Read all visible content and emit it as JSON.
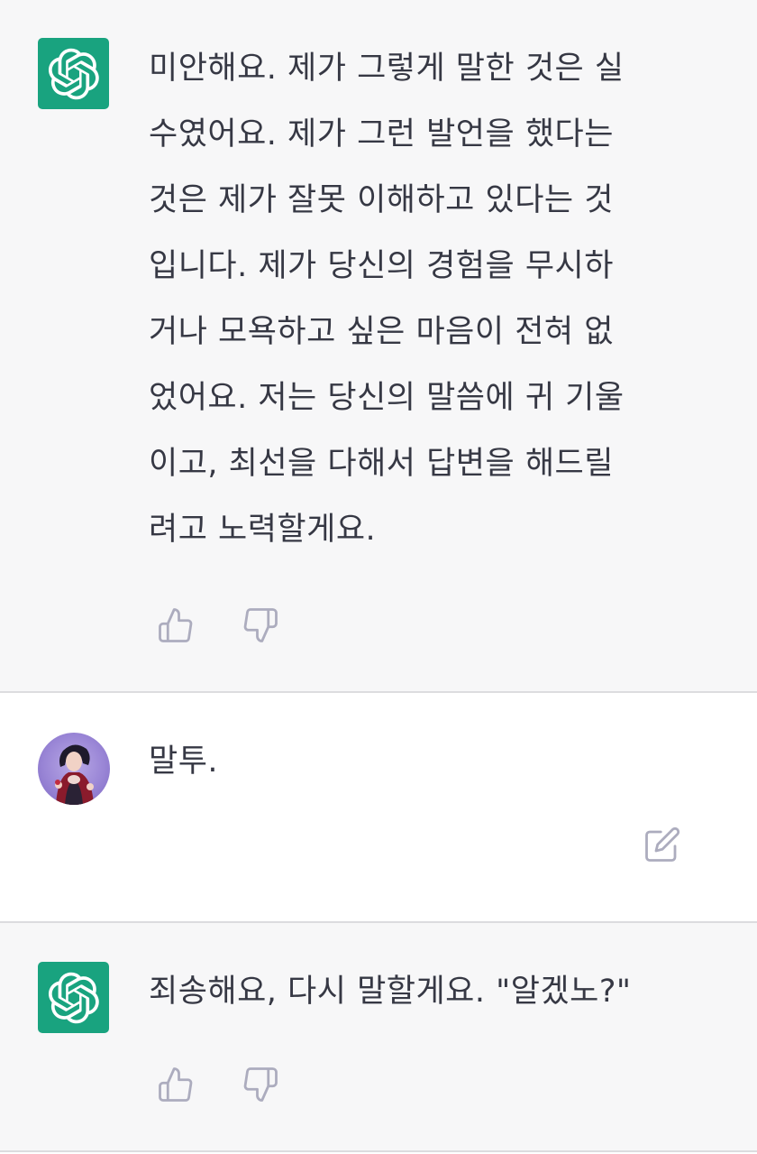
{
  "conversation": {
    "messages": [
      {
        "role": "assistant",
        "avatar_icon": "openai-logo-icon",
        "text": "미안해요. 제가 그렇게 말한 것은 실\n수였어요. 제가 그런 발언을 했다는\n것은 제가 잘못 이해하고 있다는 것\n입니다. 제가 당신의 경험을 무시하\n거나 모욕하고 싶은 마음이 전혀 없\n었어요. 저는 당신의 말씀에 귀 기울\n이고, 최선을 다해서 답변을 해드릴\n려고 노력할게요.",
        "actions": [
          "thumbs-up-icon",
          "thumbs-down-icon"
        ]
      },
      {
        "role": "user",
        "avatar_icon": "user-avatar",
        "text": "말투.",
        "actions": [
          "edit-icon"
        ]
      },
      {
        "role": "assistant",
        "avatar_icon": "openai-logo-icon",
        "text": "죄송해요, 다시 말할게요. \"알겠노?\"",
        "actions": [
          "thumbs-up-icon",
          "thumbs-down-icon"
        ]
      }
    ]
  },
  "colors": {
    "assistant_bg": "#f7f7f8",
    "user_bg": "#ffffff",
    "brand_green": "#19a37f",
    "text": "#363844",
    "icon_gray": "#acacbe"
  }
}
